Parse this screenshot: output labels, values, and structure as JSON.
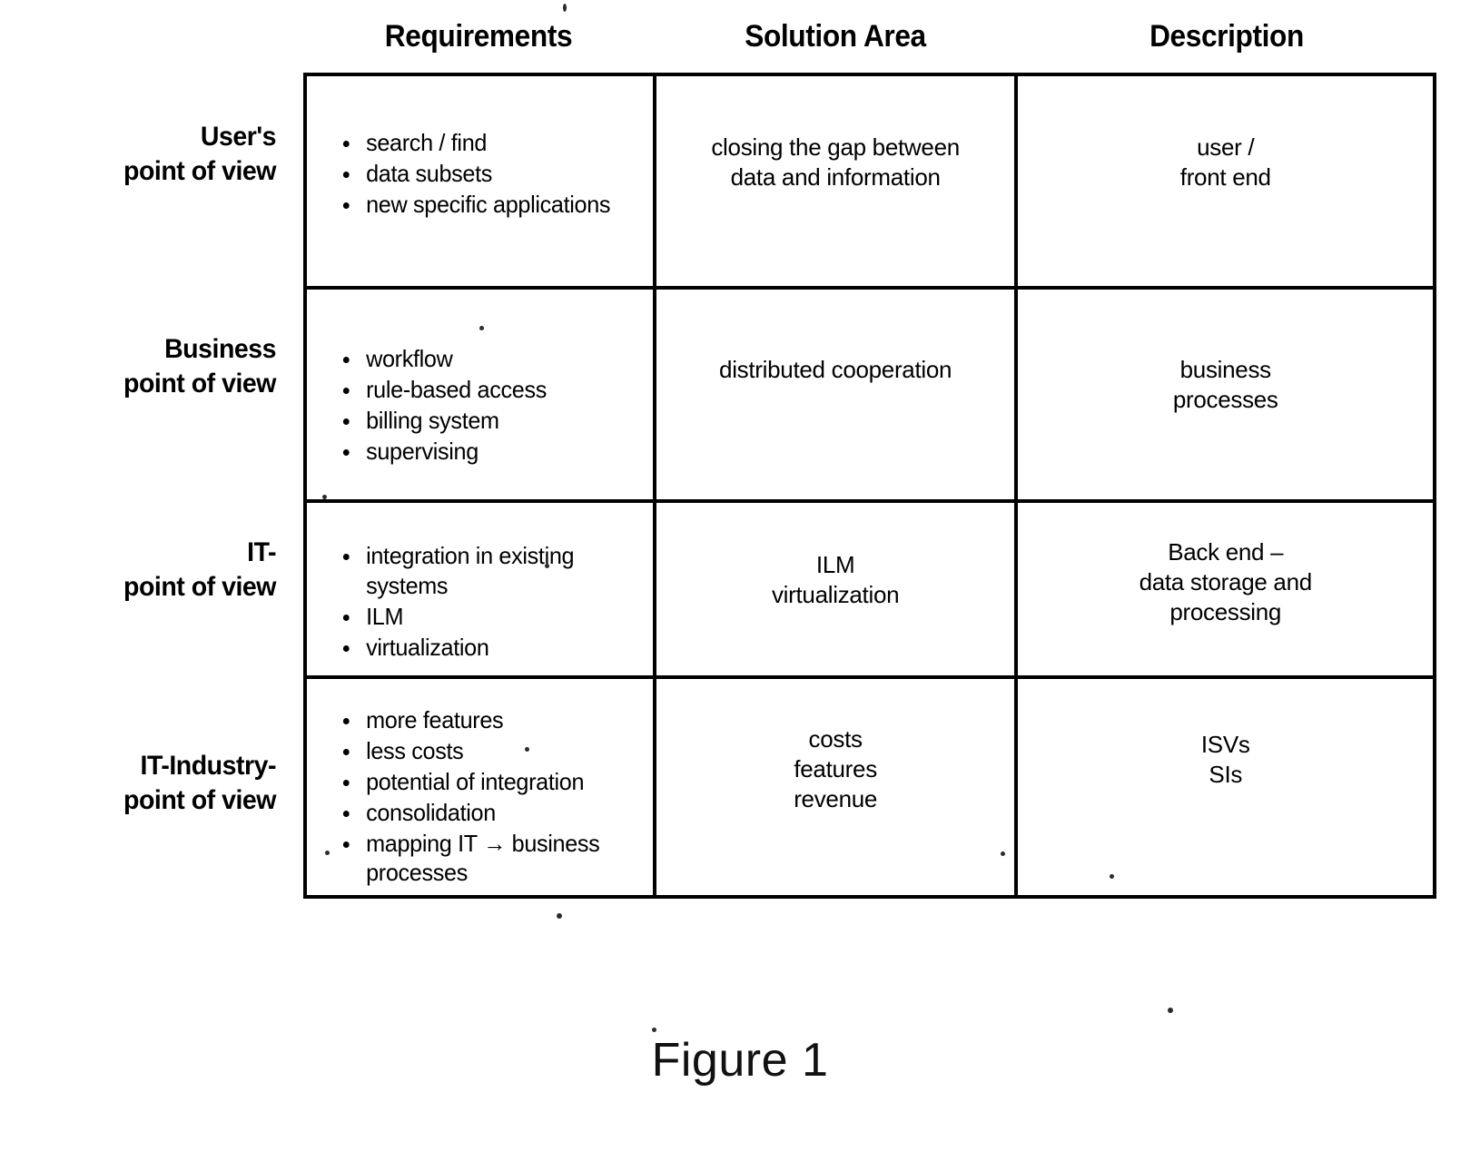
{
  "figure": {
    "caption": "Figure 1"
  },
  "table": {
    "column_headers": [
      "Requirements",
      "Solution Area",
      "Description"
    ],
    "row_labels": [
      "User's\npoint of view",
      "Business\npoint of view",
      "IT-\npoint of view",
      "IT-Industry-\npoint of view"
    ],
    "rows": [
      {
        "label_line1": "User's",
        "label_line2": "point of view",
        "requirements": [
          "search / find",
          "data subsets",
          "new specific applications"
        ],
        "solution_area": "closing the gap between\ndata and information",
        "solution_area_lines": [
          "closing the gap between",
          "data and information"
        ],
        "description": "user /\nfront end",
        "description_lines": [
          "user /",
          "front end"
        ]
      },
      {
        "label_line1": "Business",
        "label_line2": "point of view",
        "requirements": [
          "workflow",
          "rule-based access",
          "billing system",
          "supervising"
        ],
        "solution_area": "distributed cooperation",
        "solution_area_lines": [
          "distributed cooperation"
        ],
        "description": "business\nprocesses",
        "description_lines": [
          "business",
          "processes"
        ]
      },
      {
        "label_line1": "IT-",
        "label_line2": "point of view",
        "requirements": [
          "integration in existing systems",
          "ILM",
          "virtualization"
        ],
        "solution_area": "ILM\nvirtualization",
        "solution_area_lines": [
          "ILM",
          "virtualization"
        ],
        "description": "Back end –\ndata storage and\nprocessing",
        "description_lines": [
          "Back end –",
          "data storage and",
          "processing"
        ]
      },
      {
        "label_line1": "IT-Industry-",
        "label_line2": "point of view",
        "requirements": [
          "more features",
          "less costs",
          "potential of integration",
          "consolidation",
          "mapping IT → business processes"
        ],
        "solution_area": "costs\nfeatures\nrevenue",
        "solution_area_lines": [
          "costs",
          "features",
          "revenue"
        ],
        "description": "ISVs\nSIs",
        "description_lines": [
          "ISVs",
          "SIs"
        ]
      }
    ]
  }
}
